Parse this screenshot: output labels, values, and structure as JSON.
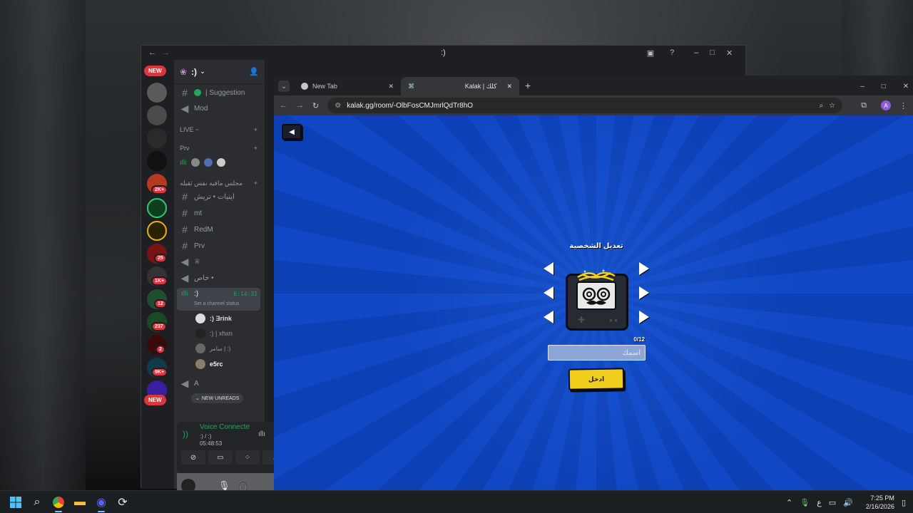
{
  "discord": {
    "window_title": ":)",
    "server_name": ":)",
    "new_pill": "NEW",
    "badges": [
      "2K+",
      "25",
      "1K+",
      "12",
      "237",
      "2",
      "9K+"
    ],
    "channels": [
      {
        "name": "| Suggestion",
        "type": "text"
      },
      {
        "name": "Mod",
        "type": "voice"
      }
    ],
    "categories": [
      {
        "label": "LIVE ~"
      },
      {
        "label": "Prv"
      },
      {
        "label": "مجلس مافيه نفس ثقيله"
      }
    ],
    "channels2": [
      {
        "name": "اينيات • تريش",
        "type": "text"
      },
      {
        "name": "mt",
        "type": "text"
      },
      {
        "name": "RedM",
        "type": "text"
      },
      {
        "name": "Prv",
        "type": "text"
      },
      {
        "name": "♕",
        "type": "voice"
      },
      {
        "name": "خاص •",
        "type": "voice"
      }
    ],
    "active_voice": {
      "name": ":)",
      "time": "6:14:31",
      "status": "Set a channel status"
    },
    "voice_users": [
      ":) Ǝrink",
      ":) | xhxn",
      "سامر | :)",
      "e5rc"
    ],
    "channel_a": "A",
    "new_unreads": "NEW UNREADS",
    "voice_connected": {
      "title": "Voice Connecte",
      "sub": ":) / :)",
      "time": "05:48:53"
    }
  },
  "chrome": {
    "tabs": [
      {
        "label": "New Tab"
      },
      {
        "label": "Kalak | كلك"
      }
    ],
    "url": "kalak.gg/room/-OlbFosCMJmrlQdTr8hO",
    "profile_initial": "A"
  },
  "game": {
    "title": "تعديل الشخصية",
    "counter": "0/12",
    "name_placeholder": "اسمك",
    "enter_label": "ادخل"
  },
  "taskbar": {
    "lang": "ع",
    "time": "7:25 PM",
    "date": "2/16/2026"
  },
  "colors": {
    "discord_bg": "#1e1f22",
    "discord_sidebar": "#2b2d31",
    "game_blue": "#1047c4",
    "enter_yellow": "#f2cf1d",
    "badge_red": "#da373c",
    "voice_green": "#23a55a"
  }
}
